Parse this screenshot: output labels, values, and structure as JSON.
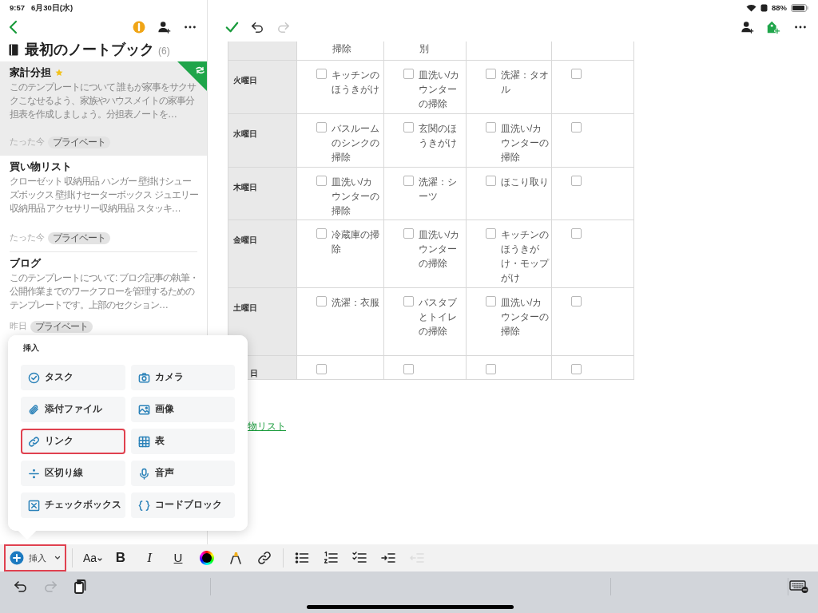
{
  "status_bar": {
    "time": "9:57",
    "date": "6月30日(水)",
    "battery": "88%"
  },
  "sidebar": {
    "notebook_title": "最初のノートブック",
    "note_count": "(6)",
    "notes": [
      {
        "title": "家計分担",
        "starred": true,
        "synced": true,
        "selected": true,
        "snippet": "このテンプレートについて 誰もが家事をサクサクこなせるよう、家族やハウスメイトの家事分担表を作成しましょう。分担表ノートを…",
        "time": "たった今",
        "tag": "プライベート"
      },
      {
        "title": "買い物リスト",
        "starred": false,
        "synced": false,
        "selected": false,
        "snippet": "クローゼット 収納用品 ハンガー 壁掛けシューズボックス 壁掛けセーターボックス ジュエリー収納用品 アクセサリー収納用品 スタッキ…",
        "time": "たった今",
        "tag": "プライベート"
      },
      {
        "title": "ブログ",
        "starred": false,
        "synced": false,
        "selected": false,
        "snippet": "このテンプレートについて: ブログ記事の執筆・公開作業までのワークフローを管理するためのテンプレートです。上部のセクション…",
        "time": "昨日",
        "tag": "プライベート"
      }
    ]
  },
  "editor_toolbar": [
    {
      "kind": "done",
      "disabled": false
    },
    {
      "kind": "undo",
      "disabled": false
    },
    {
      "kind": "redo",
      "disabled": true
    }
  ],
  "table": {
    "rows": [
      {
        "kind": "partial",
        "cells": [
          {
            "text": "掃除"
          },
          {
            "text": "別"
          },
          {},
          {}
        ]
      },
      {
        "kind": "full",
        "day": "火曜日",
        "cells": [
          {
            "text": "キッチンのほうきがけ",
            "checked": false
          },
          {
            "text": "皿洗い/カウンターの掃除",
            "checked": false
          },
          {
            "text": "洗濯：タオル",
            "checked": false
          },
          {
            "checked": false
          }
        ]
      },
      {
        "kind": "full",
        "day": "水曜日",
        "cells": [
          {
            "text": "バスルームのシンクの掃除",
            "checked": false
          },
          {
            "text": " 玄関のほうきがけ",
            "checked": false
          },
          {
            "text": "皿洗い/カウンターの掃除",
            "checked": false
          },
          {
            "checked": false
          }
        ]
      },
      {
        "kind": "full",
        "day": "木曜日",
        "cells": [
          {
            "text": "皿洗い/カウンターの掃除",
            "checked": false
          },
          {
            "text": "洗濯：シーツ",
            "checked": false
          },
          {
            "text": "ほこり取り",
            "checked": false
          },
          {
            "checked": false
          }
        ]
      },
      {
        "kind": "full",
        "day": "金曜日",
        "cells": [
          {
            "text": "冷蔵庫の掃除",
            "checked": false
          },
          {
            "text": "皿洗い/カウンターの掃除",
            "checked": false
          },
          {
            "text": "キッチンのほうきがけ・モップがけ",
            "checked": false
          },
          {
            "checked": false
          }
        ]
      },
      {
        "kind": "full",
        "day": "土曜日",
        "cells": [
          {
            "text": "洗濯：衣服",
            "checked": false
          },
          {
            "text": "バスタブとトイレの掃除",
            "checked": false
          },
          {
            "text": "皿洗い/カウンターの掃除",
            "checked": false
          },
          {
            "checked": false
          }
        ]
      },
      {
        "kind": "covered",
        "day": "日",
        "cells": [
          {
            "checked": false
          },
          {
            "checked": false
          },
          {
            "checked": false
          },
          {
            "checked": false
          }
        ]
      }
    ]
  },
  "link_text": "物リスト",
  "insert_menu": {
    "title": "挿入",
    "items": [
      {
        "kind": "task",
        "label": "タスク",
        "highlighted": false
      },
      {
        "kind": "camera",
        "label": "カメラ",
        "highlighted": false
      },
      {
        "kind": "attachment",
        "label": "添付ファイル",
        "highlighted": false
      },
      {
        "kind": "image",
        "label": "画像",
        "highlighted": false
      },
      {
        "kind": "link",
        "label": "リンク",
        "highlighted": true
      },
      {
        "kind": "table",
        "label": "表",
        "highlighted": false
      },
      {
        "kind": "divider",
        "label": "区切り線",
        "highlighted": false
      },
      {
        "kind": "audio",
        "label": "音声",
        "highlighted": false
      },
      {
        "kind": "checkbox",
        "label": "チェックボックス",
        "highlighted": false
      },
      {
        "kind": "code",
        "label": "コードブロック",
        "highlighted": false
      }
    ]
  },
  "format_toolbar": {
    "insert_button": {
      "label": "挿入",
      "highlighted": true
    },
    "items": [
      {
        "kind": "font",
        "label": "Aa",
        "disabled": false
      },
      {
        "kind": "bold",
        "label": "B",
        "disabled": false
      },
      {
        "kind": "italic",
        "label": "I",
        "disabled": false
      },
      {
        "kind": "underline",
        "label": "U",
        "disabled": false
      },
      {
        "kind": "color",
        "disabled": false
      },
      {
        "kind": "highlight",
        "disabled": false
      },
      {
        "kind": "link",
        "disabled": false
      },
      {
        "kind": "sep"
      },
      {
        "kind": "bullets",
        "disabled": false
      },
      {
        "kind": "numbered",
        "disabled": false
      },
      {
        "kind": "checklist",
        "disabled": false
      },
      {
        "kind": "indent",
        "disabled": false
      },
      {
        "kind": "outdent",
        "disabled": true
      }
    ]
  },
  "keyboard_bar": [
    {
      "kind": "undo",
      "disabled": false
    },
    {
      "kind": "redo",
      "disabled": true
    },
    {
      "kind": "clipboard",
      "disabled": false
    }
  ]
}
